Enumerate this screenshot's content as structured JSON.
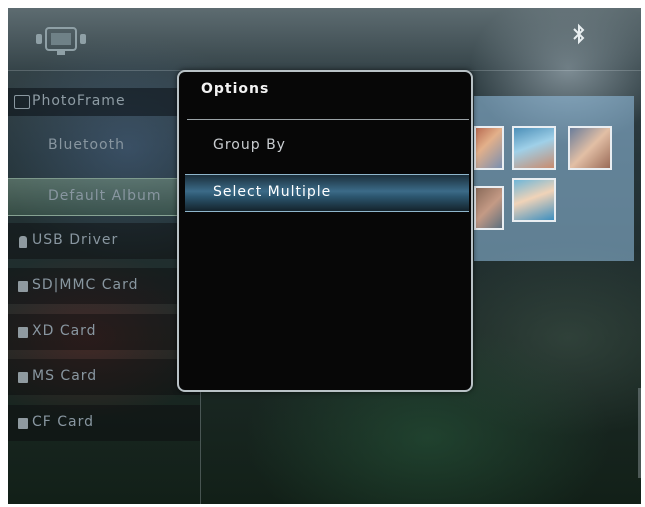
{
  "sidebar": {
    "title": "PhotoFrame",
    "items": [
      {
        "label": "Bluetooth"
      },
      {
        "label": "Default Album"
      },
      {
        "label": "USB Driver"
      },
      {
        "label": "SD|MMC Card"
      },
      {
        "label": "XD Card"
      },
      {
        "label": "MS Card"
      },
      {
        "label": "CF Card"
      }
    ]
  },
  "dialog": {
    "title": "Options",
    "items": [
      {
        "label": "Group By"
      },
      {
        "label": "Select Multiple"
      }
    ]
  },
  "icons": {
    "device": "photoframe-device-icon",
    "bluetooth": "bluetooth-icon"
  },
  "colors": {
    "highlight": "#3c6b88",
    "dialog_bg": "#070707",
    "dialog_border": "#b9c2c6"
  }
}
